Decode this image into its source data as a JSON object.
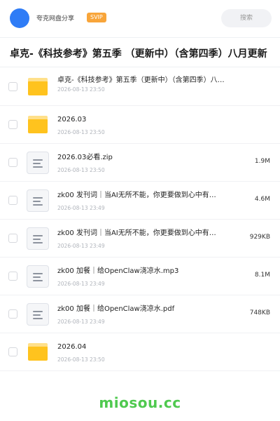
{
  "header": {
    "share_name": "夸克网盘分享",
    "badge": "SVIP",
    "search_label": "搜索",
    "avatar_color": "#2f7cf6"
  },
  "title": "卓克-《科技参考》第五季 （更新中）（含第四季）八月更新",
  "files": [
    {
      "type": "folder",
      "name": "卓克-《科技参考》第五季（更新中）（含第四季）八…",
      "date": "2026-08-13 23:50",
      "size": ""
    },
    {
      "type": "folder",
      "name": "2026.03",
      "date": "2026-08-13 23:50",
      "size": ""
    },
    {
      "type": "file",
      "name": "2026.03必看.zip",
      "date": "2026-08-13 23:50",
      "size": "1.9M"
    },
    {
      "type": "file",
      "name": "zk00 发刊词｜当AI无所不能，你更要做到心中有…",
      "date": "2026-08-13 23:49",
      "size": "4.6M"
    },
    {
      "type": "file",
      "name": "zk00 发刊词｜当AI无所不能，你更要做到心中有…",
      "date": "2026-08-13 23:49",
      "size": "929KB"
    },
    {
      "type": "file",
      "name": "zk00 加餐｜给OpenClaw浇凉水.mp3",
      "date": "2026-08-13 23:49",
      "size": "8.1M"
    },
    {
      "type": "file",
      "name": "zk00 加餐｜给OpenClaw浇凉水.pdf",
      "date": "2026-08-13 23:49",
      "size": "748KB"
    },
    {
      "type": "folder",
      "name": "2026.04",
      "date": "2026-08-13 23:50",
      "size": ""
    }
  ],
  "footer": {
    "brand": "miosou.cc",
    "brand_color": "#4fc94f"
  },
  "icons": {
    "folder": "folder-icon",
    "file": "document-icon"
  }
}
